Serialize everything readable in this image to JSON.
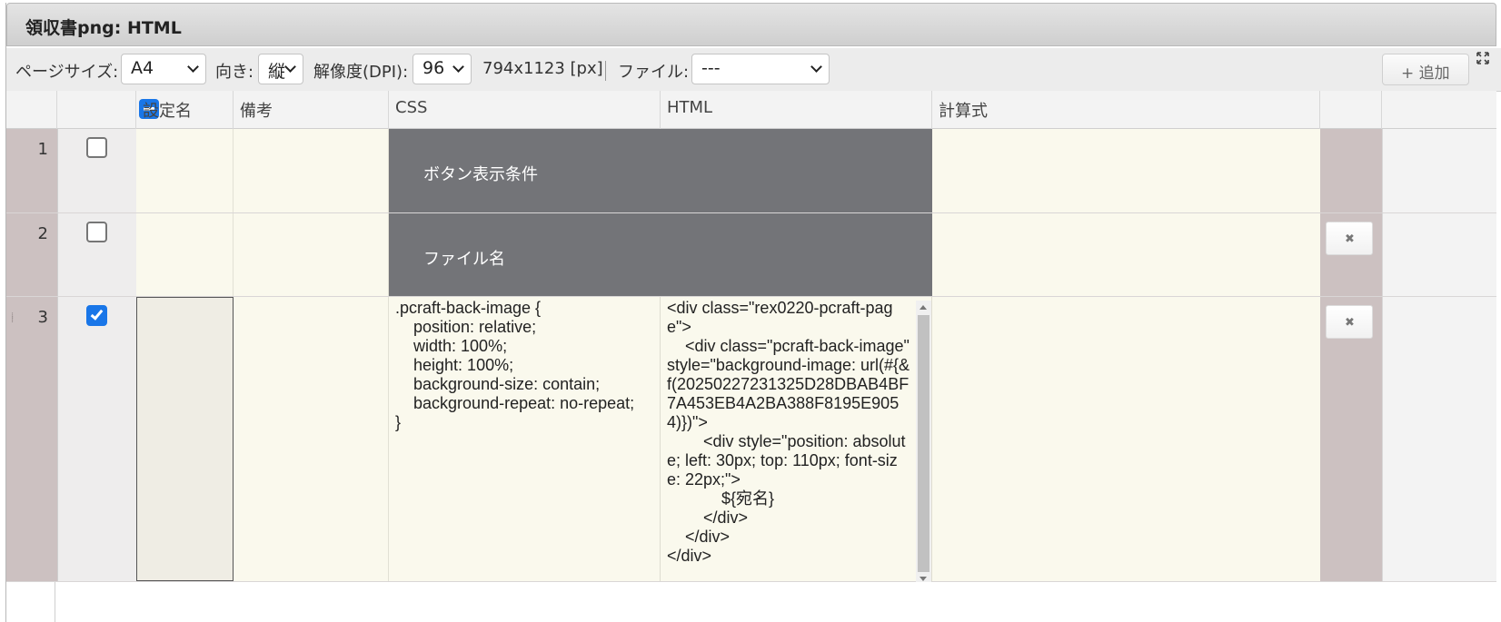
{
  "window": {
    "title": "領収書png: HTML"
  },
  "toolbar": {
    "page_size_label": "ページサイズ:",
    "page_size_value": "A4",
    "orientation_label": "向き:",
    "orientation_value": "縦",
    "dpi_label": "解像度(DPI):",
    "dpi_value": "96",
    "dimensions": "794x1123 [px]",
    "file_label": "ファイル:",
    "file_value": "---",
    "add_label": "+ 追加"
  },
  "columns": {
    "name": "設定名",
    "note": "備考",
    "css": "CSS",
    "html": "HTML",
    "formula": "計算式"
  },
  "rows": [
    {
      "num": "1",
      "checked": false,
      "merged_label": "ボタン表示条件"
    },
    {
      "num": "2",
      "checked": false,
      "merged_label": "ファイル名"
    },
    {
      "num": "3",
      "checked": true,
      "css": ".pcraft-back-image {\n    position: relative;\n    width: 100%;\n    height: 100%;\n    background-size: contain;\n    background-repeat: no-repeat;\n}",
      "html": "<div class=\"rex0220-pcraft-page\">\n    <div class=\"pcraft-back-image\" style=\"background-image: url(#{&f(20250227231325D28DBAB4BF7A453EB4A2BA388F8195E9054)})\">\n        <div style=\"position: absolute; left: 30px; top: 110px; font-size: 22px;\">\n            ${宛名}\n        </div>\n    </div>\n</div>"
    }
  ],
  "icons": {
    "expand": "expand-icon",
    "delete": "close-icon",
    "drag": "drag-handle-icon"
  },
  "colors": {
    "accent": "#1976e8",
    "merged_cell": "#737478",
    "row_gutter": "#ccc1c1",
    "cell_bg": "#faf9ed"
  }
}
